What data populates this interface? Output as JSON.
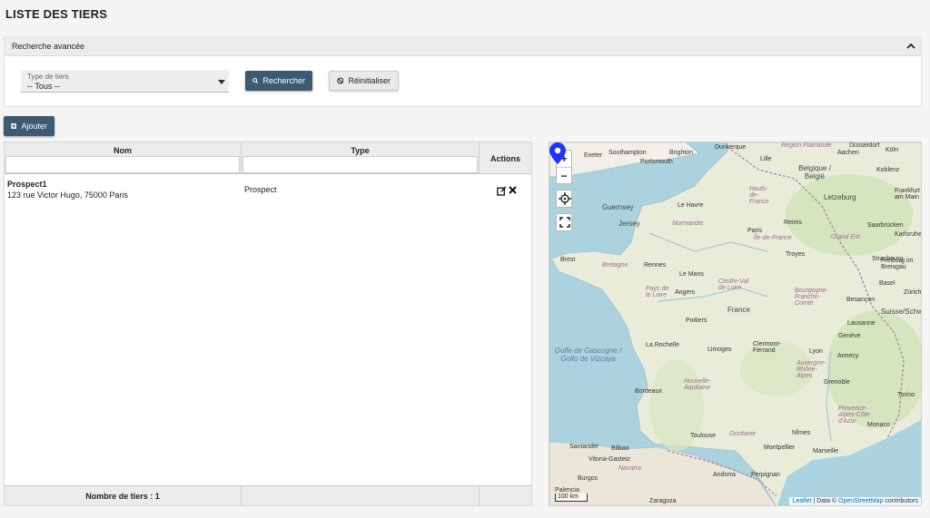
{
  "page": {
    "title": "LISTE DES TIERS"
  },
  "search": {
    "header": "Recherche avancée",
    "type_label": "Type de tiers",
    "type_value": "-- Tous --",
    "search_button": "Rechercher",
    "reset_button": "Réinitialiser"
  },
  "toolbar": {
    "add_button": "Ajouter"
  },
  "table": {
    "columns": [
      "Nom",
      "Type",
      "Actions"
    ],
    "rows": [
      {
        "name": "Prospect1",
        "address": "123 rue Victor Hugo, 75000 Paris",
        "type": "Prospect"
      }
    ],
    "footer": "Nombre de tiers : 1"
  },
  "map": {
    "scale": "100 km",
    "attribution_leaflet": "Leaflet",
    "attribution_sep": " | Data © ",
    "attribution_osm": "OpenStreetMap",
    "attribution_tail": " contributors",
    "labels": [
      "Southampton",
      "Brighton",
      "Dunkerque",
      "Exeter",
      "Portsmouth",
      "Lille",
      "Région Flamande",
      "Aachen",
      "Düsseldorf",
      "Köln",
      "Belgique / België",
      "Koblenz",
      "Guernsey",
      "Jersey",
      "Le Havre",
      "Hauts-de-France",
      "Reims",
      "Letzeburg",
      "Frankfurt am Main",
      "Normandie",
      "Paris",
      "Île-de-France",
      "Grand Est",
      "Saarbrücken",
      "Karlsruhe",
      "Brest",
      "Bretagne",
      "Rennes",
      "Le Mans",
      "Troyes",
      "Strasbourg",
      "Freiburg im Breisgau",
      "Pays de la Loire",
      "Angers",
      "Centre-Val de Loire",
      "Bourgogne-Franche-Comté",
      "Besançon",
      "Basel",
      "Zürich",
      "France",
      "Poitiers",
      "Lausanne",
      "Suisse/Schweiz",
      "Golfe de Gascogne / Golfo de Vizcaya",
      "La Rochelle",
      "Limoges",
      "Clermont-Ferrand",
      "Genève",
      "Annecy",
      "Lyon",
      "Auvergne-Rhône-Alpes",
      "Nouvelle-Aquitaine",
      "Bordeaux",
      "Grenoble",
      "Torino",
      "Toulouse",
      "Occitanie",
      "Nîmes",
      "Provence-Alpes-Côte d'Azur",
      "Monaco",
      "Marseille",
      "Santander",
      "Bilbao",
      "Vitoria-Gasteiz",
      "Navarra",
      "Andorra",
      "Perpignan",
      "Burgos",
      "Palencia",
      "Zaragoza",
      "Montpellier"
    ]
  },
  "colors": {
    "primary": "#3d5a73",
    "marker": "#1d33ff",
    "sea": "#aad3df",
    "land": "#f2efe9"
  }
}
